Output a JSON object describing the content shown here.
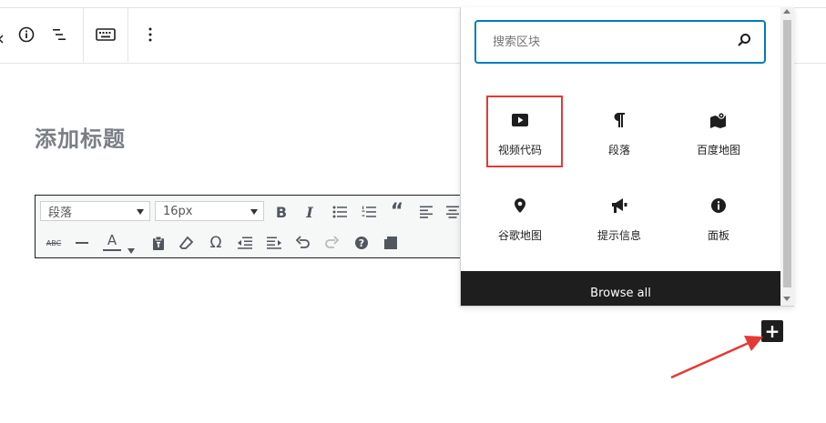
{
  "editor": {
    "title_placeholder": "添加标题"
  },
  "top_toolbar": {
    "icons": [
      "info-icon",
      "list-view-icon",
      "keyboard-icon",
      "more-options-icon"
    ]
  },
  "classic_toolbar": {
    "format_select": "段落",
    "font_size_select": "16px",
    "strikethrough_label": "ABC",
    "text_color_label": "A",
    "special_char_label": "Ω",
    "help_label": "?"
  },
  "inserter": {
    "search_placeholder": "搜索区块",
    "blocks": [
      {
        "label": "视频代码",
        "icon": "video-play-icon"
      },
      {
        "label": "段落",
        "icon": "paragraph-icon"
      },
      {
        "label": "百度地图",
        "icon": "map-icon"
      },
      {
        "label": "谷歌地图",
        "icon": "location-pin-icon"
      },
      {
        "label": "提示信息",
        "icon": "megaphone-icon"
      },
      {
        "label": "面板",
        "icon": "info-circle-icon"
      }
    ],
    "browse_all": "Browse all"
  },
  "add_block_label": "+",
  "colors": {
    "accent": "#007cba",
    "highlight": "#e53935",
    "dark": "#1e1e1e"
  }
}
